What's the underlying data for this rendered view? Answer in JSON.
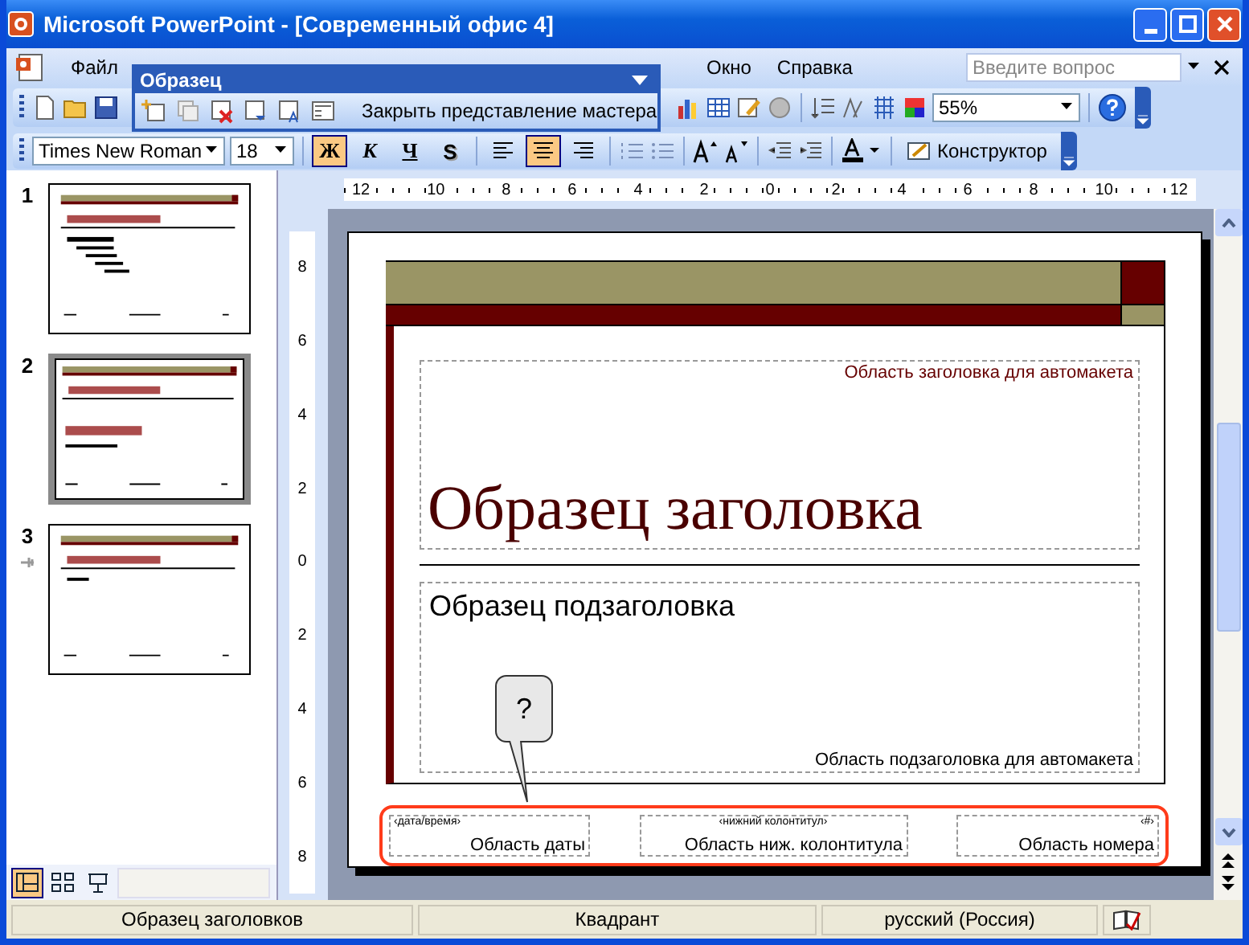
{
  "window": {
    "title": "Microsoft PowerPoint - [Современный офис 4]"
  },
  "menu": {
    "left": [
      "Файл"
    ],
    "right": [
      "Окно",
      "Справка"
    ]
  },
  "help_search": {
    "placeholder": "Введите вопрос"
  },
  "master_toolbar": {
    "title": "Образец",
    "close_label": "Закрыть представление мастера"
  },
  "standard_toolbar": {
    "zoom": "55%"
  },
  "formatting_toolbar": {
    "font": "Times New Roman",
    "size": "18",
    "styles": [
      {
        "label": "Ж",
        "kind": "bold",
        "selected": true
      },
      {
        "label": "К",
        "kind": "italic",
        "selected": false
      },
      {
        "label": "Ч",
        "kind": "underline",
        "selected": false
      },
      {
        "label": "S",
        "kind": "shadow",
        "selected": false
      }
    ],
    "alignment": [
      {
        "kind": "left",
        "selected": false
      },
      {
        "kind": "center",
        "selected": true
      },
      {
        "kind": "right",
        "selected": false
      }
    ],
    "designer": "Конструктор"
  },
  "thumbnails": [
    {
      "number": "1",
      "selected": false
    },
    {
      "number": "2",
      "selected": true
    },
    {
      "number": "3",
      "selected": false
    }
  ],
  "view_buttons": [
    {
      "kind": "normal",
      "selected": true
    },
    {
      "kind": "sorter",
      "selected": false
    },
    {
      "kind": "slideshow",
      "selected": false
    }
  ],
  "rulers": {
    "horizontal": [
      "12",
      "10",
      "8",
      "6",
      "4",
      "2",
      "0",
      "2",
      "4",
      "6",
      "8",
      "10",
      "12"
    ],
    "vertical": [
      "8",
      "6",
      "4",
      "2",
      "0",
      "2",
      "4",
      "6",
      "8"
    ]
  },
  "slide": {
    "title_area_label": "Область заголовка для автомакета",
    "title": "Образец заголовка",
    "subtitle": "Образец подзаголовка",
    "subtitle_area_label": "Область подзаголовка для автомакета",
    "footer": [
      {
        "tag": "‹дата/время›",
        "label": "Область даты"
      },
      {
        "tag": "‹нижний колонтитул›",
        "label": "Область ниж. колонтитула"
      },
      {
        "tag": "‹#›",
        "label": "Область номера"
      }
    ],
    "callout": "?"
  },
  "status_bar": [
    "Образец заголовков",
    "Квадрант",
    "русский (Россия)"
  ]
}
